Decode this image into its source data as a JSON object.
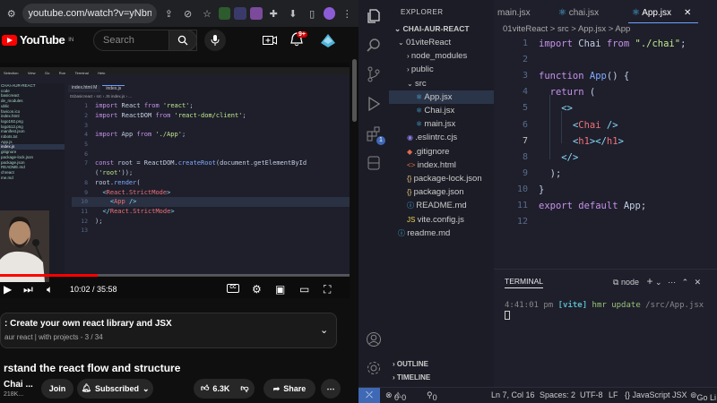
{
  "browser": {
    "url": "youtube.com/watch?v=yNbnA5pr..."
  },
  "youtube": {
    "logo_text": "YouTube",
    "logo_region": "IN",
    "search_placeholder": "Search",
    "notif_count": "9+",
    "video": {
      "time": "10:02 / 35:58",
      "progress": 0.279,
      "mini_menu": [
        "Selection",
        "View",
        "Go",
        "Run",
        "Terminal",
        "Help"
      ],
      "mini_files": [
        "CHAI-AUR-REACT",
        "code",
        "basicreact",
        "",
        "de_modules",
        "ublic",
        "favicon.ico",
        "index.html",
        "logo192.png",
        "logo512.png",
        "manifest.json",
        "robots.txt",
        "",
        "App.js",
        "index.js",
        "gitignore",
        "package-lock.json",
        "package.json",
        "README.md",
        "chreact",
        "me.md"
      ],
      "mini_tabs": [
        "index.html M",
        "index.js"
      ],
      "mini_breadcrumb": "01basicreact › src › JS index.js › ...",
      "mini_lines": [
        {
          "n": "1",
          "t": "import React from 'react';"
        },
        {
          "n": "2",
          "t": "import ReactDOM from 'react-dom/client';"
        },
        {
          "n": "3",
          "t": ""
        },
        {
          "n": "4",
          "t": "import App from './App';"
        },
        {
          "n": "5",
          "t": ""
        },
        {
          "n": "6",
          "t": ""
        },
        {
          "n": "7",
          "t": "const root = ReactDOM.createRoot(document.getElementById"
        },
        {
          "n": "",
          "t": "('root'));"
        },
        {
          "n": "8",
          "t": "root.render("
        },
        {
          "n": "9",
          "t": "  <React.StrictMode>"
        },
        {
          "n": "10",
          "t": "    <App />"
        },
        {
          "n": "11",
          "t": "  </React.StrictMode>"
        },
        {
          "n": "12",
          "t": ");"
        },
        {
          "n": "13",
          "t": ""
        }
      ]
    },
    "playlist_title": ": Create your own react library and JSX",
    "playlist_sub": "aur react | with projects - 3 / 34",
    "video_title": "rstand the react flow and structure",
    "channel": "Chai ...",
    "subscribers": "218K...",
    "join_label": "Join",
    "subscribed_label": "Subscribed",
    "likes": "6.3K",
    "share_label": "Share"
  },
  "vscode": {
    "explorer_label": "EXPLORER",
    "project": "CHAI-AUR-REACT",
    "tree": [
      {
        "label": "01viteReact",
        "indent": 1,
        "kind": "folder-open"
      },
      {
        "label": "node_modules",
        "indent": 2,
        "kind": "folder"
      },
      {
        "label": "public",
        "indent": 2,
        "kind": "folder"
      },
      {
        "label": "src",
        "indent": 2,
        "kind": "folder-open"
      },
      {
        "label": "App.jsx",
        "indent": 3,
        "kind": "react",
        "selected": true
      },
      {
        "label": "Chai.jsx",
        "indent": 3,
        "kind": "react"
      },
      {
        "label": "main.jsx",
        "indent": 3,
        "kind": "react"
      },
      {
        "label": ".eslintrc.cjs",
        "indent": 2,
        "kind": "eslint"
      },
      {
        "label": ".gitignore",
        "indent": 2,
        "kind": "git"
      },
      {
        "label": "index.html",
        "indent": 2,
        "kind": "html"
      },
      {
        "label": "package-lock.json",
        "indent": 2,
        "kind": "json"
      },
      {
        "label": "package.json",
        "indent": 2,
        "kind": "json"
      },
      {
        "label": "README.md",
        "indent": 2,
        "kind": "info"
      },
      {
        "label": "vite.config.js",
        "indent": 2,
        "kind": "js"
      },
      {
        "label": "readme.md",
        "indent": 1,
        "kind": "info"
      }
    ],
    "outline_label": "OUTLINE",
    "timeline_label": "TIMELINE",
    "tabs": [
      "main.jsx",
      "chai.jsx",
      "App.jsx"
    ],
    "breadcrumb": "01viteReact > src > App.jsx > App",
    "code_lines": [
      {
        "n": "1",
        "t": "import Chai from \"./chai\";"
      },
      {
        "n": "2",
        "t": ""
      },
      {
        "n": "3",
        "t": "function App() {"
      },
      {
        "n": "4",
        "t": "  return ("
      },
      {
        "n": "5",
        "t": "    <>"
      },
      {
        "n": "6",
        "t": "      <Chai />"
      },
      {
        "n": "7",
        "t": "      <h1></h1>"
      },
      {
        "n": "8",
        "t": "    </>"
      },
      {
        "n": "9",
        "t": "  );"
      },
      {
        "n": "10",
        "t": "}"
      },
      {
        "n": "11",
        "t": "export default App;"
      },
      {
        "n": "12",
        "t": ""
      }
    ],
    "terminal_label": "TERMINAL",
    "terminal_shell": "node",
    "terminal_line": "4:41:01 pm [vite] hmr update /src/App.jsx",
    "status": {
      "errors": "0",
      "warnings": "0",
      "ports": "0",
      "position": "Ln 7, Col 16",
      "spaces": "Spaces: 2",
      "encoding": "UTF-8",
      "eol": "LF",
      "language": "{} JavaScript JSX",
      "golive": "Go Li"
    }
  }
}
